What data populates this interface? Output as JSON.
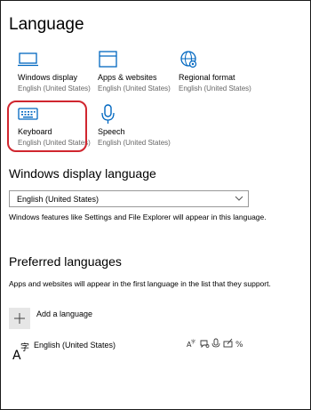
{
  "page": {
    "title": "Language"
  },
  "tiles": [
    {
      "title": "Windows display",
      "subtitle": "English (United States)",
      "icon": "monitor-icon"
    },
    {
      "title": "Apps & websites",
      "subtitle": "English (United States)",
      "icon": "browser-window-icon"
    },
    {
      "title": "Regional format",
      "subtitle": "English (United States)",
      "icon": "globe-gear-icon"
    },
    {
      "title": "Keyboard",
      "subtitle": "English (United States)",
      "icon": "keyboard-icon"
    },
    {
      "title": "Speech",
      "subtitle": "English (United States)",
      "icon": "microphone-icon"
    }
  ],
  "display_language": {
    "heading": "Windows display language",
    "selected": "English (United States)",
    "description": "Windows features like Settings and File Explorer will appear in this language."
  },
  "preferred": {
    "heading": "Preferred languages",
    "description": "Apps and websites will appear in the first language in the list that they support.",
    "add_label": "Add a language",
    "languages": [
      {
        "name": "English (United States)",
        "features": [
          "language-pack-icon",
          "speech-recognition-icon",
          "text-to-speech-icon",
          "handwriting-icon",
          "basic-typing-icon"
        ]
      }
    ]
  },
  "colors": {
    "accent": "#0067c0",
    "highlight": "#d0262f"
  }
}
